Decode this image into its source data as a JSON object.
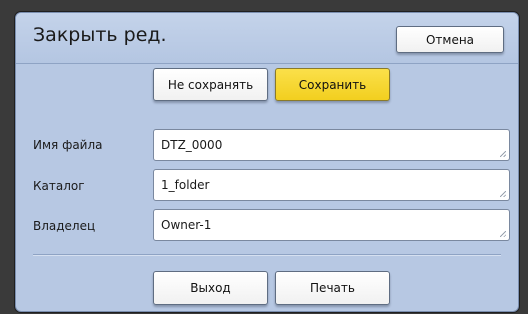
{
  "dialog": {
    "title": "Закрыть ред.",
    "cancel_label": "Отмена"
  },
  "save_options": {
    "no_save_label": "Не сохранять",
    "save_label": "Сохранить"
  },
  "fields": [
    {
      "label": "Имя файла",
      "value": "DTZ_0000"
    },
    {
      "label": "Каталог",
      "value": "1_folder"
    },
    {
      "label": "Владелец",
      "value": "Owner-1"
    }
  ],
  "footer": {
    "exit_label": "Выход",
    "print_label": "Печать"
  },
  "colors": {
    "dialog_background": "#b7c8e3",
    "save_button": "#f7d83a"
  }
}
